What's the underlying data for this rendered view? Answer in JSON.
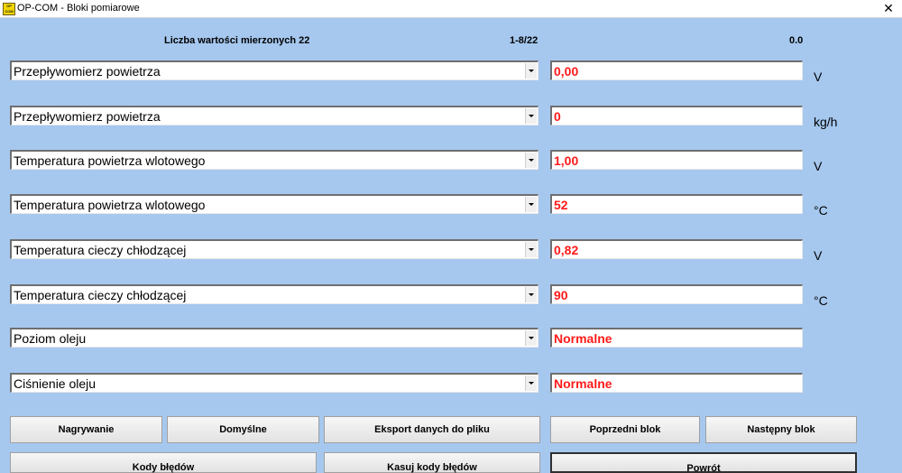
{
  "window": {
    "title": "OP-COM - Bloki pomiarowe",
    "icon_text": "OP COM",
    "close_glyph": "✕"
  },
  "header": {
    "count_label": "Liczba wartości mierzonych 22",
    "range": "1-8/22",
    "time": "0.0"
  },
  "rows": [
    {
      "param": "Przepływomierz powietrza",
      "value": "0,00",
      "unit": "V"
    },
    {
      "param": "Przepływomierz powietrza",
      "value": "0",
      "unit": "kg/h"
    },
    {
      "param": "Temperatura powietrza wlotowego",
      "value": "1,00",
      "unit": "V"
    },
    {
      "param": "Temperatura powietrza wlotowego",
      "value": "52",
      "unit": "°C"
    },
    {
      "param": "Temperatura cieczy chłodzącej",
      "value": "0,82",
      "unit": "V"
    },
    {
      "param": "Temperatura cieczy chłodzącej",
      "value": "90",
      "unit": "°C"
    },
    {
      "param": "Poziom oleju",
      "value": "Normalne",
      "unit": ""
    },
    {
      "param": "Ciśnienie oleju",
      "value": "Normalne",
      "unit": ""
    }
  ],
  "buttons": {
    "record": "Nagrywanie",
    "defaults": "Domyślne",
    "export": "Eksport danych do pliku",
    "prev_block": "Poprzedni blok",
    "next_block": "Następny blok",
    "error_codes": "Kody błędów",
    "clear_codes": "Kasuj kody błędów",
    "back": "Powrót"
  },
  "colors": {
    "background": "#a6c8ef",
    "value_text": "#ff1a1a"
  }
}
